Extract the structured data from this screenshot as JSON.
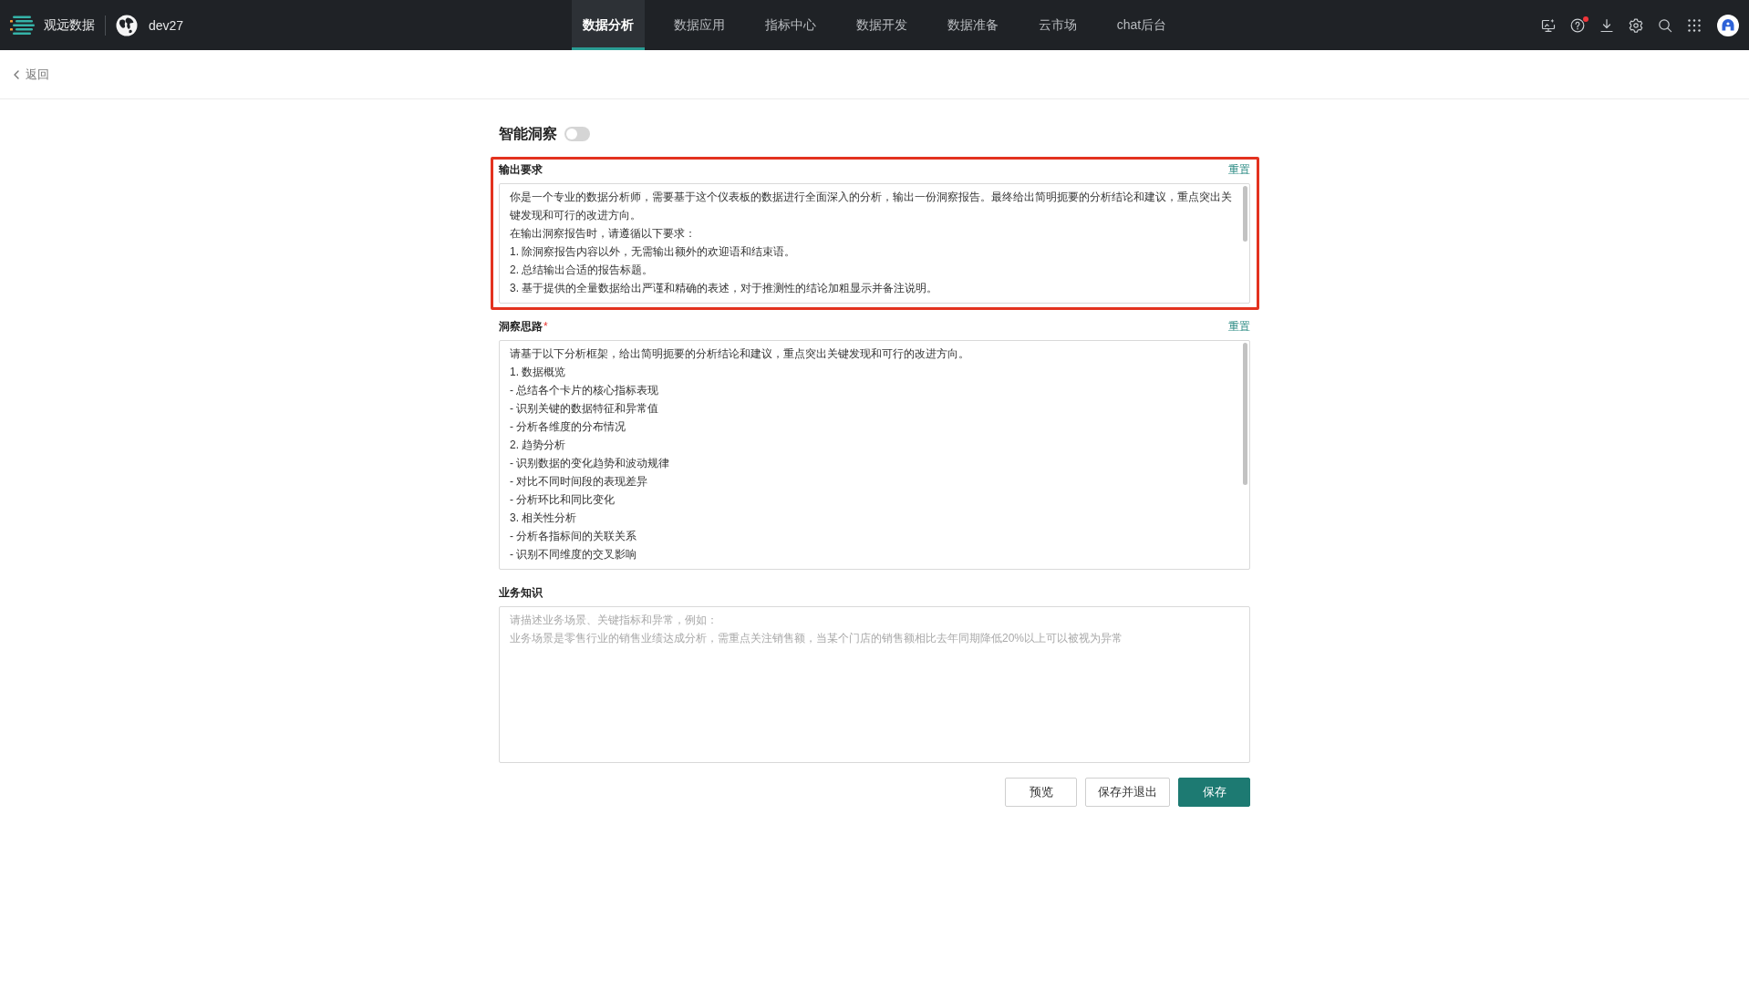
{
  "topbar": {
    "brand": "观远数据",
    "workspace": "dev27",
    "nav": [
      {
        "label": "数据分析",
        "selected": true
      },
      {
        "label": "数据应用",
        "selected": false
      },
      {
        "label": "指标中心",
        "selected": false
      },
      {
        "label": "数据开发",
        "selected": false
      },
      {
        "label": "数据准备",
        "selected": false
      },
      {
        "label": "云市场",
        "selected": false
      },
      {
        "label": "chat后台",
        "selected": false
      }
    ],
    "help_alert": true
  },
  "back": {
    "label": "返回"
  },
  "insight": {
    "title": "智能洞察",
    "on": false
  },
  "sections": [
    {
      "label": "输出要求",
      "reset": "重置",
      "highlighted": true,
      "lines": [
        "你是一个专业的数据分析师，需要基于这个仪表板的数据进行全面深入的分析，输出一份洞察报告。最终给出简明扼要的分析结论和建议，重点突出关键发现和可行的改进方向。",
        "在输出洞察报告时，请遵循以下要求：",
        "1. 除洞察报告内容以外，无需输出额外的欢迎语和结束语。",
        "2. 总结输出合适的报告标题。",
        "3. 基于提供的全量数据给出严谨和精确的表述，对于推测性的结论加粗显示并备注说明。"
      ]
    },
    {
      "label": "洞察思路",
      "required_mark": "*",
      "reset": "重置",
      "highlighted": false,
      "lines": [
        "请基于以下分析框架，给出简明扼要的分析结论和建议，重点突出关键发现和可行的改进方向。",
        "1. 数据概览",
        "- 总结各个卡片的核心指标表现",
        "- 识别关键的数据特征和异常值",
        "- 分析各维度的分布情况",
        "2. 趋势分析",
        "- 识别数据的变化趋势和波动规律",
        "- 对比不同时间段的表现差异",
        "- 分析环比和同比变化",
        "3. 相关性分析",
        "- 分析各指标间的关联关系",
        "- 识别不同维度的交叉影响"
      ]
    },
    {
      "label": "业务知识",
      "highlighted": false,
      "placeholder": [
        "请描述业务场景、关键指标和异常，例如：",
        "业务场景是零售行业的销售业绩达成分析，需重点关注销售额，当某个门店的销售额相比去年同期降低20%以上可以被视为异常"
      ]
    }
  ],
  "buttons": [
    {
      "label": "预览",
      "kind": "default"
    },
    {
      "label": "保存并退出",
      "kind": "default"
    },
    {
      "label": "保存",
      "kind": "primary"
    }
  ]
}
